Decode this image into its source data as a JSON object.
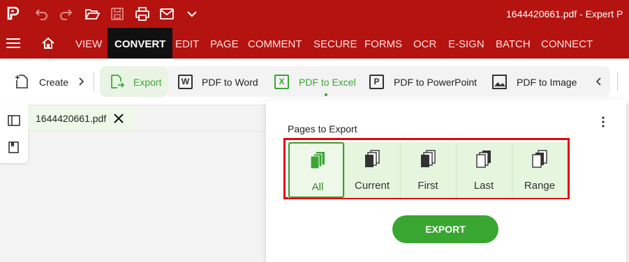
{
  "window": {
    "title": "1644420661.pdf  -  Expert P"
  },
  "quick_access": [
    "app-logo-icon",
    "undo-icon",
    "redo-icon",
    "open-folder-icon",
    "save-icon",
    "print-icon",
    "email-icon",
    "chevron-down-icon"
  ],
  "menu": {
    "items": [
      "VIEW",
      "CONVERT",
      "EDIT",
      "PAGE",
      "COMMENT",
      "SECURE",
      "FORMS",
      "OCR",
      "E-SIGN",
      "BATCH",
      "CONNECT"
    ],
    "active": "CONVERT"
  },
  "ribbon": {
    "create_label": "Create",
    "export_label": "Export",
    "pdf_to_word": "PDF to Word",
    "pdf_to_excel": "PDF to Excel",
    "pdf_to_powerpoint": "PDF to PowerPoint",
    "pdf_to_image": "PDF to Image",
    "word_letter": "W",
    "excel_letter": "X",
    "ppt_letter": "P"
  },
  "tab": {
    "filename": "1644420661.pdf"
  },
  "export_panel": {
    "heading": "Pages to Export",
    "options": [
      "All",
      "Current",
      "First",
      "Last",
      "Range"
    ],
    "selected": "All",
    "button": "EXPORT"
  },
  "colors": {
    "brand_red": "#b4130f",
    "accent_green": "#3aa632",
    "highlight_red": "#e0070f"
  }
}
